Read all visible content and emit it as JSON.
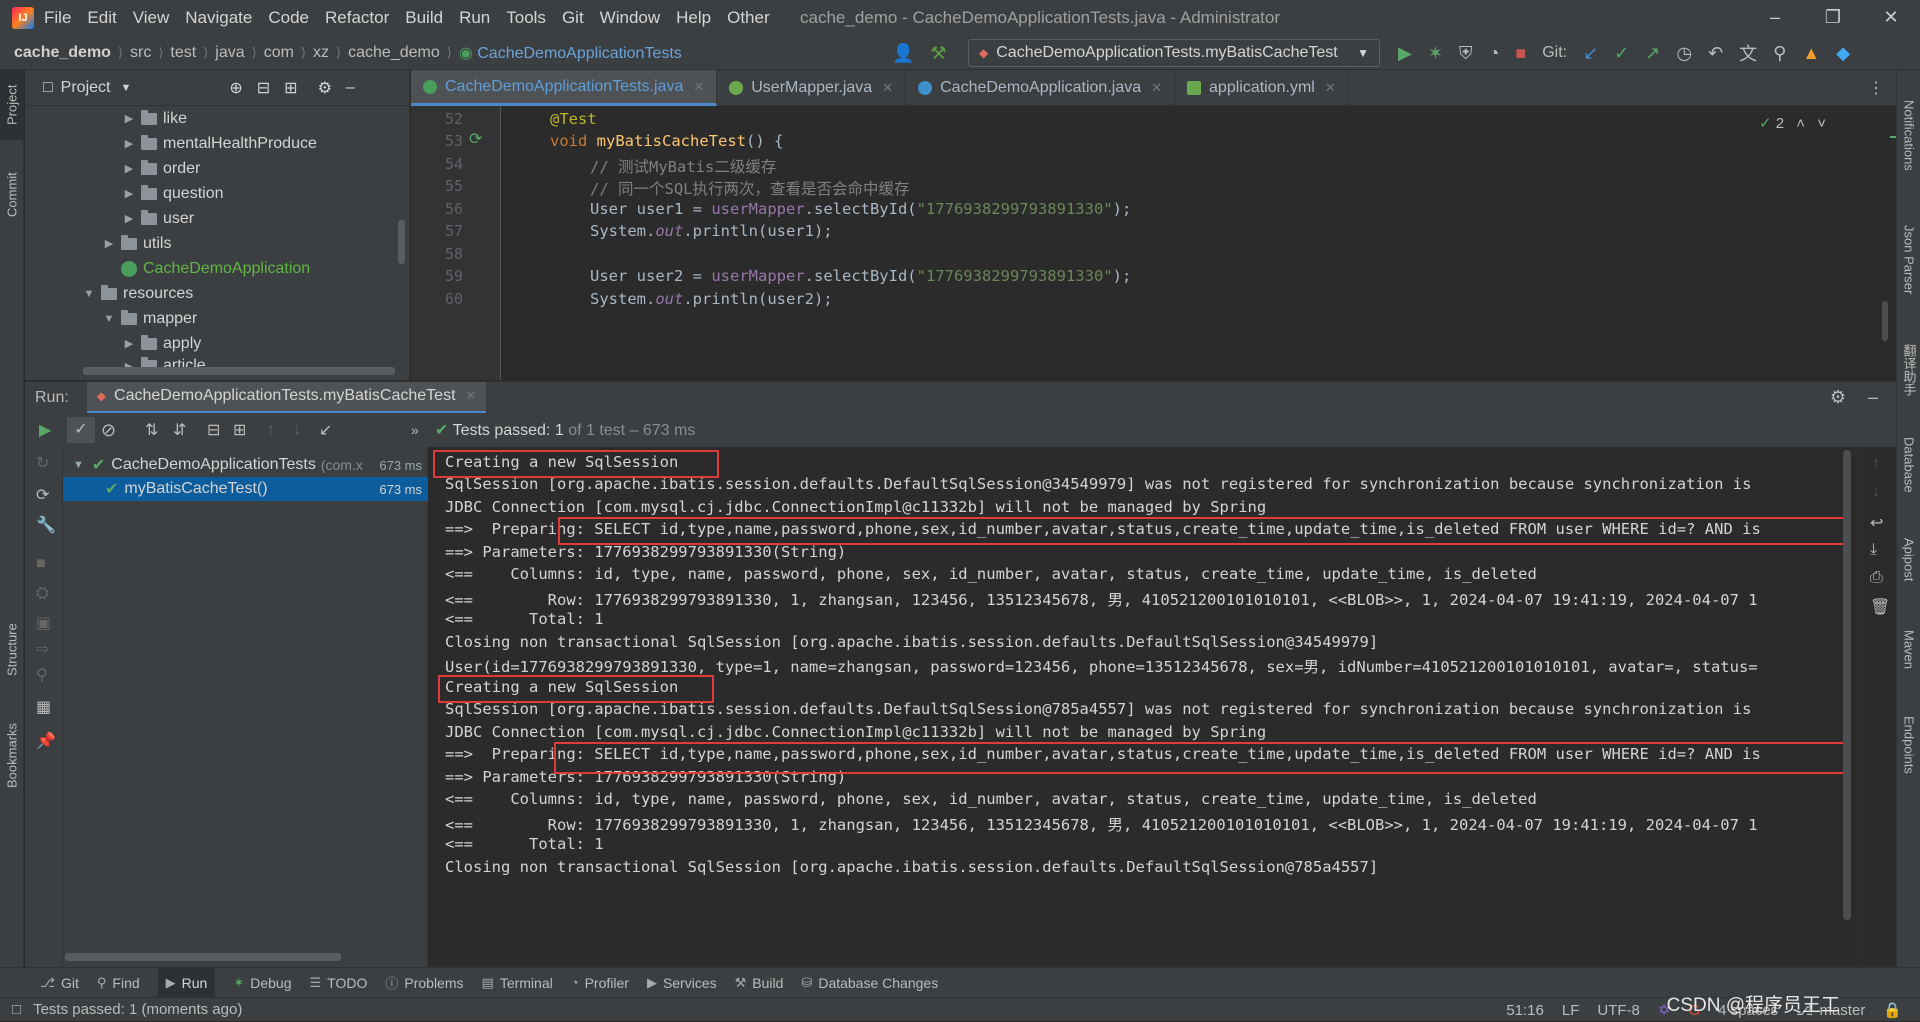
{
  "titlebar": {
    "menu": [
      "File",
      "Edit",
      "View",
      "Navigate",
      "Code",
      "Refactor",
      "Build",
      "Run",
      "Tools",
      "Git",
      "Window",
      "Help",
      "Other"
    ],
    "title": "cache_demo - CacheDemoApplicationTests.java - Administrator"
  },
  "navbar": {
    "breadcrumbs": [
      "cache_demo",
      "src",
      "test",
      "java",
      "com",
      "xz",
      "cache_demo"
    ],
    "current_class": "CacheDemoApplicationTests",
    "run_config": "CacheDemoApplicationTests.myBatisCacheTest",
    "git_label": "Git:"
  },
  "project": {
    "header": "Project",
    "tree": [
      {
        "label": "like",
        "type": "folder"
      },
      {
        "label": "mentalHealthProduce",
        "type": "folder"
      },
      {
        "label": "order",
        "type": "folder"
      },
      {
        "label": "question",
        "type": "folder"
      },
      {
        "label": "user",
        "type": "folder"
      },
      {
        "label": "utils",
        "type": "folder"
      },
      {
        "label": "CacheDemoApplication",
        "type": "class"
      },
      {
        "label": "resources",
        "type": "folder"
      },
      {
        "label": "mapper",
        "type": "folder"
      },
      {
        "label": "apply",
        "type": "folder"
      },
      {
        "label": "article",
        "type": "folder"
      }
    ]
  },
  "editor": {
    "tabs": [
      "CacheDemoApplicationTests.java",
      "UserMapper.java",
      "CacheDemoApplication.java",
      "application.yml"
    ],
    "inspection_count": "2",
    "line_numbers": [
      "52",
      "53",
      "54",
      "55",
      "56",
      "57",
      "58",
      "59",
      "60"
    ],
    "code": {
      "l51": "✲˅",
      "l52": "@Test",
      "l53_kw": "void ",
      "l53_fn": "myBatisCacheTest",
      "l53_rest": "() {",
      "l54": "// 测试MyBatis二级缓存",
      "l55": "// 同一个SQL执行两次，查看是否会命中缓存",
      "l56_a": "User user1 = ",
      "l56_b": "userMapper",
      "l56_c": ".selectById(",
      "l56_d": "\"1776938299793891330\"",
      "l56_e": ");",
      "l57_a": "System.",
      "l57_b": "out",
      "l57_c": ".println(user1);",
      "l59_a": "User user2 = ",
      "l59_b": "userMapper",
      "l59_c": ".selectById(",
      "l59_d": "\"1776938299793891330\"",
      "l59_e": ");",
      "l60_a": "System.",
      "l60_b": "out",
      "l60_c": ".println(user2);"
    }
  },
  "run": {
    "label": "Run:",
    "tab": "CacheDemoApplicationTests.myBatisCacheTest",
    "status_pass": "Tests passed:",
    "status_count": "1",
    "status_rest": "of 1 test – 673 ms",
    "tree": [
      {
        "label": "CacheDemoApplicationTests",
        "suffix": "(com.x",
        "ms": "673 ms"
      },
      {
        "label": "myBatisCacheTest()",
        "ms": "673 ms"
      }
    ],
    "console": [
      "Creating a new SqlSession",
      "SqlSession [org.apache.ibatis.session.defaults.DefaultSqlSession@34549979] was not registered for synchronization because synchronization is",
      "JDBC Connection [com.mysql.cj.jdbc.ConnectionImpl@c11332b] will not be managed by Spring",
      "==>  Preparing: SELECT id,type,name,password,phone,sex,id_number,avatar,status,create_time,update_time,is_deleted FROM user WHERE id=? AND is",
      "==> Parameters: 1776938299793891330(String)",
      "<==    Columns: id, type, name, password, phone, sex, id_number, avatar, status, create_time, update_time, is_deleted",
      "<==        Row: 1776938299793891330, 1, zhangsan, 123456, 13512345678, 男, 410521200101010101, <<BLOB>>, 1, 2024-04-07 19:41:19, 2024-04-07 1",
      "<==      Total: 1",
      "Closing non transactional SqlSession [org.apache.ibatis.session.defaults.DefaultSqlSession@34549979]",
      "User(id=1776938299793891330, type=1, name=zhangsan, password=123456, phone=13512345678, sex=男, idNumber=410521200101010101, avatar=, status=",
      "Creating a new SqlSession",
      "SqlSession [org.apache.ibatis.session.defaults.DefaultSqlSession@785a4557] was not registered for synchronization because synchronization is",
      "JDBC Connection [com.mysql.cj.jdbc.ConnectionImpl@c11332b] will not be managed by Spring",
      "==>  Preparing: SELECT id,type,name,password,phone,sex,id_number,avatar,status,create_time,update_time,is_deleted FROM user WHERE id=? AND is",
      "==> Parameters: 1776938299793891330(String)",
      "<==    Columns: id, type, name, password, phone, sex, id_number, avatar, status, create_time, update_time, is_deleted",
      "<==        Row: 1776938299793891330, 1, zhangsan, 123456, 13512345678, 男, 410521200101010101, <<BLOB>>, 1, 2024-04-07 19:41:19, 2024-04-07 1",
      "<==      Total: 1",
      "Closing non transactional SqlSession [org.apache.ibatis.session.defaults.DefaultSqlSession@785a4557]"
    ]
  },
  "left_strip": [
    "Project",
    "Commit",
    "Structure",
    "Bookmarks"
  ],
  "right_strip": [
    "Notifications",
    "Json Parser",
    "翻译助手",
    "Database",
    "Apipost",
    "Maven",
    "Endpoints"
  ],
  "bottom_tools": [
    "Git",
    "Find",
    "Run",
    "Debug",
    "TODO",
    "Problems",
    "Terminal",
    "Profiler",
    "Services",
    "Build",
    "Database Changes"
  ],
  "statusbar": {
    "message": "Tests passed: 1 (moments ago)",
    "position": "51:16",
    "line_sep": "LF",
    "encoding": "UTF-8",
    "indent": "4 spaces",
    "branch": "master",
    "watermark": "CSDN @程序员王工"
  },
  "colors": {
    "accent": "#4a88c7",
    "highlight_box": "#e03a3a",
    "pass_green": "#62b543",
    "bg_editor": "#2b2b2b",
    "bg_panel": "#3c3f41"
  }
}
